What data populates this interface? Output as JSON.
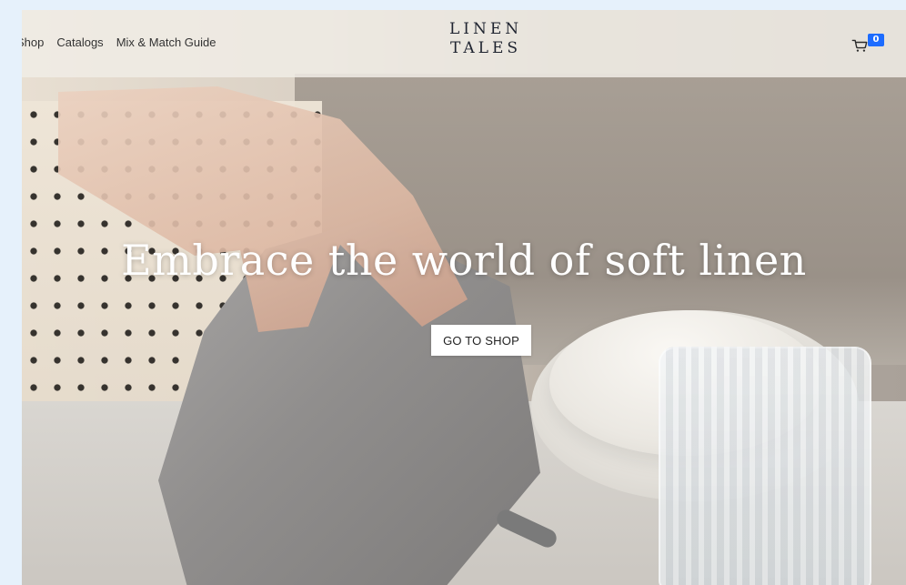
{
  "navigation": {
    "links": [
      "Shop",
      "Catalogs",
      "Mix & Match Guide"
    ]
  },
  "brand": {
    "line1": "LINEN",
    "line2": "TALES"
  },
  "cart": {
    "count": "0",
    "icon": "cart-icon",
    "badge_color": "#1d6cff"
  },
  "hero": {
    "headline": "Embrace the world of soft linen",
    "cta_label": "GO TO SHOP"
  }
}
